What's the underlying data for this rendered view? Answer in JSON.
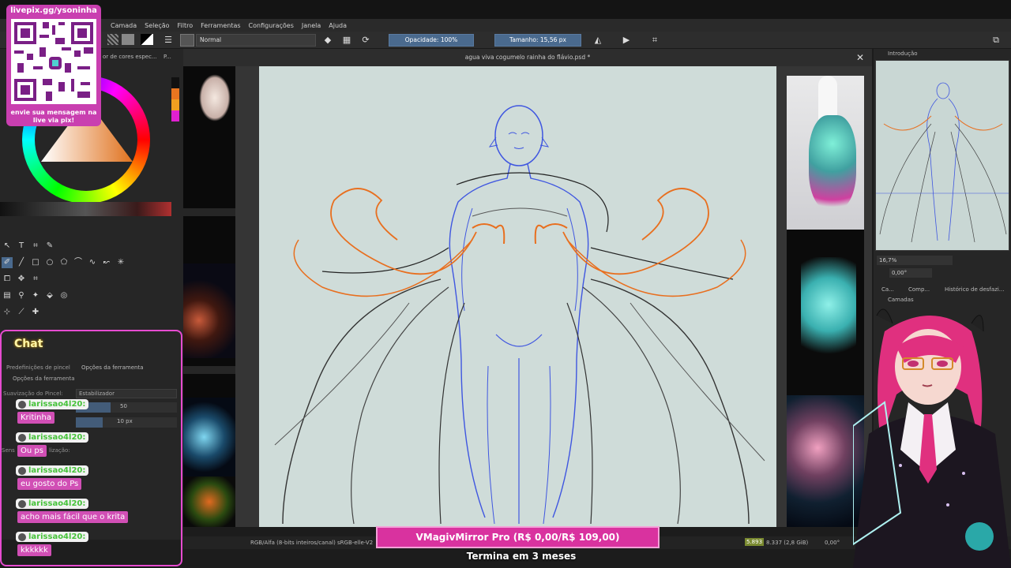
{
  "app": {
    "document_title": "agua viva cogumelo rainha do flávio.psd *",
    "menu": [
      "Camada",
      "Seleção",
      "Filtro",
      "Ferramentas",
      "Configurações",
      "Janela",
      "Ajuda"
    ]
  },
  "toolbar": {
    "blend_mode": "Normal",
    "opacity": "Opacidade: 100%",
    "size": "Tamanho: 15,56 px"
  },
  "left_dock": {
    "color_tab": "or de cores espec...",
    "color_tab2": "P...",
    "tabs": [
      "Predefinições de pincel",
      "Opções da ferramenta"
    ],
    "tool_options_title": "Opções da ferramenta",
    "smoothing_label": "Suavização do Pincel:",
    "smoothing_value": "Estabilizador",
    "distance_value": "50",
    "delay_value": "10 px",
    "sensitivity_label": "Sens",
    "stabilization_label": "lização:"
  },
  "right_dock": {
    "overview_title": "Introdução",
    "zoom": "16,7%",
    "rotation": "0,00°",
    "tabs": [
      "Ca...",
      "Comp...",
      "Histórico de desfazi..."
    ],
    "layers_title": "Camadas"
  },
  "status_bar": {
    "color_space": "RGB/Alfa (8-bits inteiros/canal)  sRGB-elle-V2",
    "memory_a": "5.893",
    "memory_b": "8.337 (2,8 GiB)",
    "rotation": "0,00°"
  },
  "overlay": {
    "qr_title": "livepix.gg/ysoninha",
    "qr_caption": "envie sua mensagem na live via pix!",
    "chat_label": "Chat",
    "chat": [
      {
        "user": "larissao4l20:",
        "msg": "Kritinha"
      },
      {
        "user": "larissao4l20:",
        "msg": "Ou ps"
      },
      {
        "user": "larissao4l20:",
        "msg": "eu gosto do Ps"
      },
      {
        "user": "larissao4l20:",
        "msg": "acho mais fácil que o krita"
      },
      {
        "user": "larissao4l20:",
        "msg": "kkkkkk"
      }
    ],
    "sub_goal": "VMagivMirror Pro (R$ 0,00/R$ 109,00)",
    "sub_timer": "Termina em 3 meses"
  },
  "colors": {
    "accent_pink": "#d9329f",
    "chat_border": "#e64bd0",
    "krita_blue": "#4a6a8e",
    "canvas": "#cfdcd9",
    "sketch_blue": "#3f56e0",
    "sketch_orange": "#e86f1f"
  },
  "icons": [
    "eraser-icon",
    "checker-icon",
    "reload-icon",
    "mirror-horizontal-icon",
    "mirror-vertical-icon",
    "crop-icon",
    "close-icon"
  ]
}
